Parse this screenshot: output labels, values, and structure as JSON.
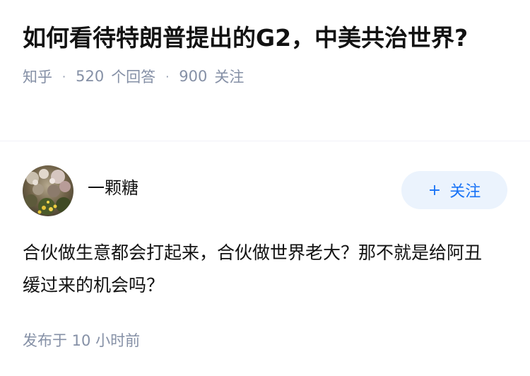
{
  "question": {
    "title": "如何看待特朗普提出的G2，中美共治世界?",
    "source": "知乎",
    "answer_count": "520",
    "answer_label": "个回答",
    "follower_count": "900",
    "follower_label": "关注"
  },
  "answer": {
    "author_name": "一颗糖",
    "follow_label": "关注",
    "content": "合伙做生意都会打起来，合伙做世界老大？那不就是给阿丑缓过来的机会吗？",
    "published_time": "发布于  10 小时前"
  },
  "icons": {
    "follow": "plus-icon",
    "avatar": "user-avatar"
  },
  "colors": {
    "meta_gray": "#8590a6",
    "follow_blue": "#1772f6",
    "follow_bg": "#ebf3fd"
  }
}
